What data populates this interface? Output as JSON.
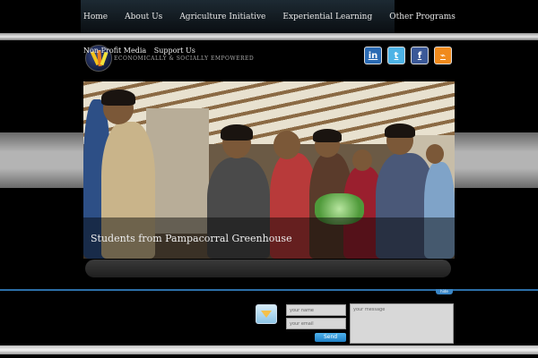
{
  "nav": {
    "items": [
      "Home",
      "About Us",
      "Agriculture Initiative",
      "Experiential Learning",
      "Other Programs"
    ]
  },
  "header": {
    "sublinks": [
      "Non-Profit Media",
      "Support Us"
    ],
    "tagline": "ECONOMICALLY & SOCIALLY EMPOWERED"
  },
  "social": {
    "icons": [
      "linkedin-icon",
      "twitter-icon",
      "facebook-icon",
      "rss-icon"
    ],
    "glyphs": [
      "in",
      "t",
      "f",
      "⌁"
    ]
  },
  "hero": {
    "caption": "Students from Pampacorral Greenhouse"
  },
  "footer": {
    "tab_label": "hide",
    "name_placeholder": "your name",
    "email_placeholder": "your email",
    "message_placeholder": "your message",
    "send_label": "Send"
  },
  "colors": {
    "accent": "#2c6fa8",
    "send_button": "#1f7fc4"
  }
}
